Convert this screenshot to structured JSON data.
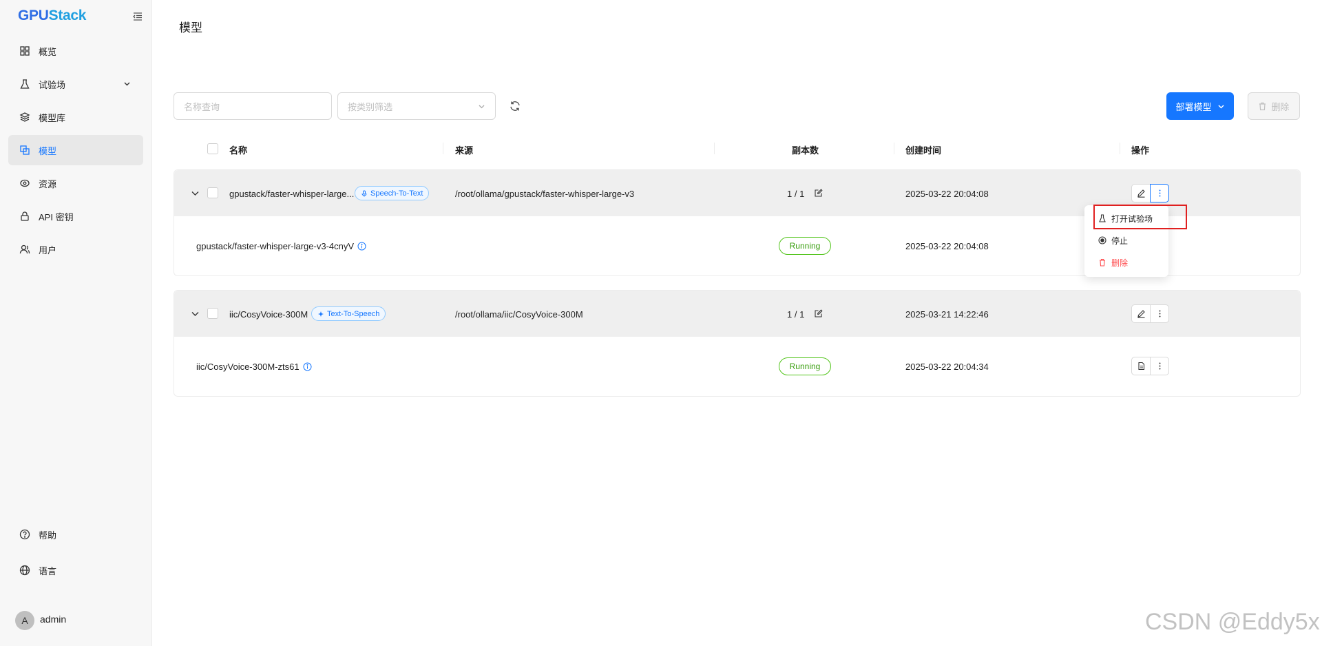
{
  "app": {
    "logo_part1": "GPU",
    "logo_part2": "Stack"
  },
  "sidebar": {
    "items": [
      {
        "label": "概览",
        "icon": "dashboard-icon"
      },
      {
        "label": "试验场",
        "icon": "flask-icon",
        "expandable": true
      },
      {
        "label": "模型库",
        "icon": "layers-icon"
      },
      {
        "label": "模型",
        "icon": "models-icon",
        "active": true
      },
      {
        "label": "资源",
        "icon": "resources-icon"
      },
      {
        "label": "API 密钥",
        "icon": "lock-icon"
      },
      {
        "label": "用户",
        "icon": "users-icon"
      }
    ],
    "bottom": [
      {
        "label": "帮助",
        "icon": "help-icon"
      },
      {
        "label": "语言",
        "icon": "globe-icon"
      }
    ],
    "user": {
      "avatar_letter": "A",
      "name": "admin"
    }
  },
  "page": {
    "title": "模型"
  },
  "toolbar": {
    "search_placeholder": "名称查询",
    "filter_placeholder": "按类别筛选",
    "deploy_label": "部署模型",
    "delete_label": "删除"
  },
  "table": {
    "columns": [
      "名称",
      "来源",
      "副本数",
      "创建时间",
      "操作"
    ],
    "groups": [
      {
        "name": "gpustack/faster-whisper-large...",
        "tag": "Speech-To-Text",
        "tag_icon": "microphone-icon",
        "source": "/root/ollama/gpustack/faster-whisper-large-v3",
        "replicas": "1 / 1",
        "created": "2025-03-22 20:04:08",
        "instance": {
          "name": "gpustack/faster-whisper-large-v3-4cnyV",
          "status": "Running",
          "created": "2025-03-22 20:04:08"
        }
      },
      {
        "name": "iic/CosyVoice-300M",
        "tag": "Text-To-Speech",
        "tag_icon": "sparkle-icon",
        "source": "/root/ollama/iic/CosyVoice-300M",
        "replicas": "1 / 1",
        "created": "2025-03-21 14:22:46",
        "instance": {
          "name": "iic/CosyVoice-300M-zts61",
          "status": "Running",
          "created": "2025-03-22 20:04:34"
        }
      }
    ]
  },
  "dropdown": {
    "items": [
      {
        "label": "打开试验场",
        "icon": "flask-icon"
      },
      {
        "label": "停止",
        "icon": "stop-icon"
      },
      {
        "label": "删除",
        "icon": "trash-icon",
        "danger": true
      }
    ]
  },
  "colors": {
    "primary": "#1677ff",
    "success": "#52c41a",
    "danger": "#ff4d4f",
    "highlight": "#e02020"
  },
  "watermark": "CSDN @Eddy5x"
}
